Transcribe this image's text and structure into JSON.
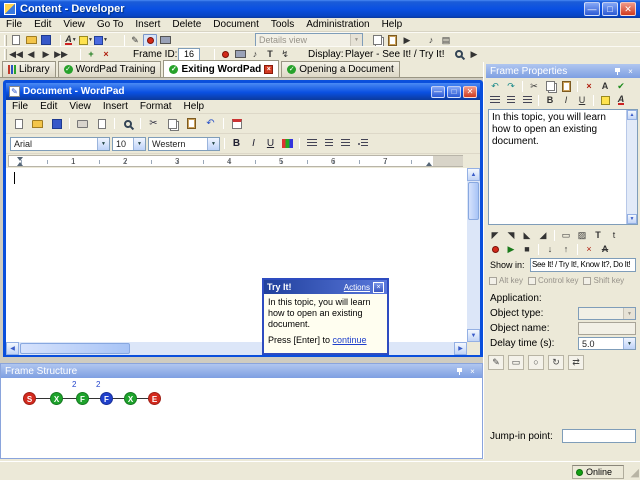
{
  "titlebar": {
    "title": "Content - Developer"
  },
  "menubar": {
    "items": [
      "File",
      "Edit",
      "View",
      "Go To",
      "Insert",
      "Delete",
      "Document",
      "Tools",
      "Administration",
      "Help"
    ]
  },
  "toolbars": {
    "details_view": "Details view",
    "frame_id_label": "Frame ID:",
    "frame_id_value": "16",
    "display_label": "Display:",
    "display_value": "Player - See It! / Try It!"
  },
  "tabs": {
    "library": "Library",
    "wordpad_training": "WordPad Training",
    "exiting_wordpad": "Exiting WordPad",
    "opening_a_document": "Opening a Document"
  },
  "wordpad": {
    "title": "Document - WordPad",
    "menu": [
      "File",
      "Edit",
      "View",
      "Insert",
      "Format",
      "Help"
    ],
    "font_name": "Arial",
    "font_size": "10",
    "script": "Western",
    "ruler": [
      "1",
      "2",
      "3",
      "4",
      "5",
      "6",
      "7"
    ]
  },
  "tryit": {
    "title": "Try It!",
    "actions_link": "Actions",
    "body": "In this topic, you will learn how to open an existing document.",
    "footer_prefix": "Press [Enter] to ",
    "footer_link": "continue"
  },
  "frame_structure": {
    "title": "Frame Structure",
    "nodes": [
      {
        "label": "S",
        "color": "#d42a1e"
      },
      {
        "label": "X",
        "color": "#1ea32c"
      },
      {
        "label": "F",
        "color": "#1ea32c",
        "badge": "2"
      },
      {
        "label": "F",
        "color": "#2040cc",
        "badge": "2"
      },
      {
        "label": "X",
        "color": "#1ea32c"
      },
      {
        "label": "E",
        "color": "#d42a1e"
      }
    ]
  },
  "frame_properties": {
    "title": "Frame Properties",
    "bubble_text": "In this topic, you will learn how to open an existing document.",
    "show_in_label": "Show in:",
    "show_in_value": "See It! / Try It!, Know It?, Do It!",
    "alt_key": "Alt key",
    "control_key": "Control key",
    "shift_key": "Shift key",
    "application_label": "Application:",
    "object_type_label": "Object type:",
    "object_name_label": "Object name:",
    "delay_label": "Delay time (s):",
    "delay_value": "5.0",
    "jump_in_label": "Jump-in point:"
  },
  "statusbar": {
    "online": "Online"
  }
}
